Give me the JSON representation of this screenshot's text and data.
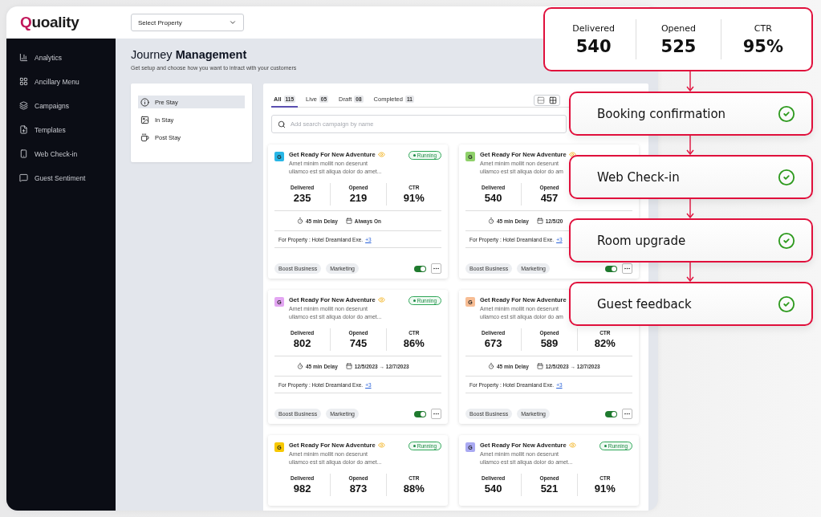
{
  "header": {
    "logo": "Quoality",
    "property_select": {
      "value": "Select Property"
    }
  },
  "sidebar": {
    "items": [
      {
        "label": "Analytics",
        "selected": false
      },
      {
        "label": "Ancillary Menu",
        "selected": false
      },
      {
        "label": "Campaigns",
        "selected": false
      },
      {
        "label": "Templates",
        "selected": false
      },
      {
        "label": "Web Check-in",
        "selected": false
      },
      {
        "label": "Guest Sentiment",
        "selected": false
      }
    ]
  },
  "page": {
    "title": "Journey",
    "title_bold": "Management",
    "subtitle": "Get setup and choose how you want to intract with your customers"
  },
  "stages": [
    {
      "label": "Pre Stay",
      "selected": true
    },
    {
      "label": "In Stay",
      "selected": false
    },
    {
      "label": "Post Stay",
      "selected": false
    }
  ],
  "tabs": [
    {
      "label": "All",
      "count": "115",
      "selected": true
    },
    {
      "label": "Live",
      "count": "05",
      "selected": false
    },
    {
      "label": "Draft",
      "count": "08",
      "selected": false
    },
    {
      "label": "Completed",
      "count": "11",
      "selected": false
    }
  ],
  "view_toggle": [
    {
      "kind": "list",
      "selected": false
    },
    {
      "kind": "grid",
      "selected": true
    }
  ],
  "search": {
    "placeholder": "Add search campaign by name"
  },
  "campaigns": [
    {
      "avatar": "G",
      "color": "#27b6e6",
      "title": "Get Ready For New Adventure",
      "status": "Running",
      "description": "Amet minim mollit non deserunt ullamco est sit aliqua dolor do amet...",
      "stats": [
        {
          "label": "Delivered",
          "value": "235"
        },
        {
          "label": "Opened",
          "value": "219"
        },
        {
          "label": "CTR",
          "value": "91%"
        }
      ],
      "delay": "45 min Delay",
      "schedule": "Always On",
      "property": "For Property : Hotel Dreamland Exe.",
      "more": "+3",
      "tags": [
        "Boost Business",
        "Marketing"
      ],
      "on": true
    },
    {
      "avatar": "G",
      "color": "#8fd16a",
      "title": "Get Ready For New Adventure",
      "description": "Amet minim mollit non deserunt ullamco est sit aliqua dolor do am",
      "stats": [
        {
          "label": "Delivered",
          "value": "540"
        },
        {
          "label": "Opened",
          "value": "457"
        }
      ],
      "delay": "45 min Delay",
      "schedule": "12/5/20",
      "property": "For Property : Hotel Dreamland Exe.",
      "more": "+3",
      "tags": [
        "Boost Business",
        "Marketing"
      ],
      "on": true
    },
    {
      "avatar": "G",
      "color": "#e3a6f2",
      "title": "Get Ready For New Adventure",
      "status": "Running",
      "description": "Amet minim mollit non deserunt ullamco est sit aliqua dolor do amet...",
      "stats": [
        {
          "label": "Delivered",
          "value": "802"
        },
        {
          "label": "Opened",
          "value": "745"
        },
        {
          "label": "CTR",
          "value": "86%"
        }
      ],
      "delay": "45 min Delay",
      "schedule": "12/5/2023 → 12/7/2023",
      "property": "For Property : Hotel Dreamland Exe.",
      "more": "+3",
      "tags": [
        "Boost Business",
        "Marketing"
      ],
      "on": true
    },
    {
      "avatar": "G",
      "color": "#f7bd94",
      "title": "Get Ready For New Adventure",
      "description": "Amet minim mollit non deserunt ullamco est sit aliqua dolor do am",
      "stats": [
        {
          "label": "Delivered",
          "value": "673"
        },
        {
          "label": "Opened",
          "value": "589"
        },
        {
          "label": "CTR",
          "value": "82%"
        }
      ],
      "delay": "45 min Delay",
      "schedule": "12/5/2023 → 12/7/2023",
      "property": "For Property : Hotel Dreamland Exe.",
      "more": "+3",
      "tags": [
        "Boost Business",
        "Marketing"
      ],
      "on": true
    },
    {
      "avatar": "G",
      "color": "#f7c800",
      "title": "Get Ready For New Adventure",
      "status": "Running",
      "description": "Amet minim mollit non deserunt ullamco est sit aliqua dolor do amet...",
      "stats": [
        {
          "label": "Delivered",
          "value": "982"
        },
        {
          "label": "Opened",
          "value": "873"
        },
        {
          "label": "CTR",
          "value": "88%"
        }
      ]
    },
    {
      "avatar": "G",
      "color": "#a9a9f2",
      "title": "Get Ready For New Adventure",
      "status": "Running",
      "description": "Amet minim mollit non deserunt ullamco est sit aliqua dolor do amet...",
      "stats": [
        {
          "label": "Delivered",
          "value": "540"
        },
        {
          "label": "Opened",
          "value": "521"
        },
        {
          "label": "CTR",
          "value": "91%"
        }
      ]
    }
  ],
  "summary": [
    {
      "label": "Delivered",
      "value": "540"
    },
    {
      "label": "Opened",
      "value": "525"
    },
    {
      "label": "CTR",
      "value": "95%"
    }
  ],
  "journey_steps": [
    {
      "label": "Booking confirmation",
      "done": true
    },
    {
      "label": "Web Check-in",
      "done": true
    },
    {
      "label": "Room upgrade",
      "done": true
    },
    {
      "label": "Guest feedback",
      "done": true
    }
  ]
}
